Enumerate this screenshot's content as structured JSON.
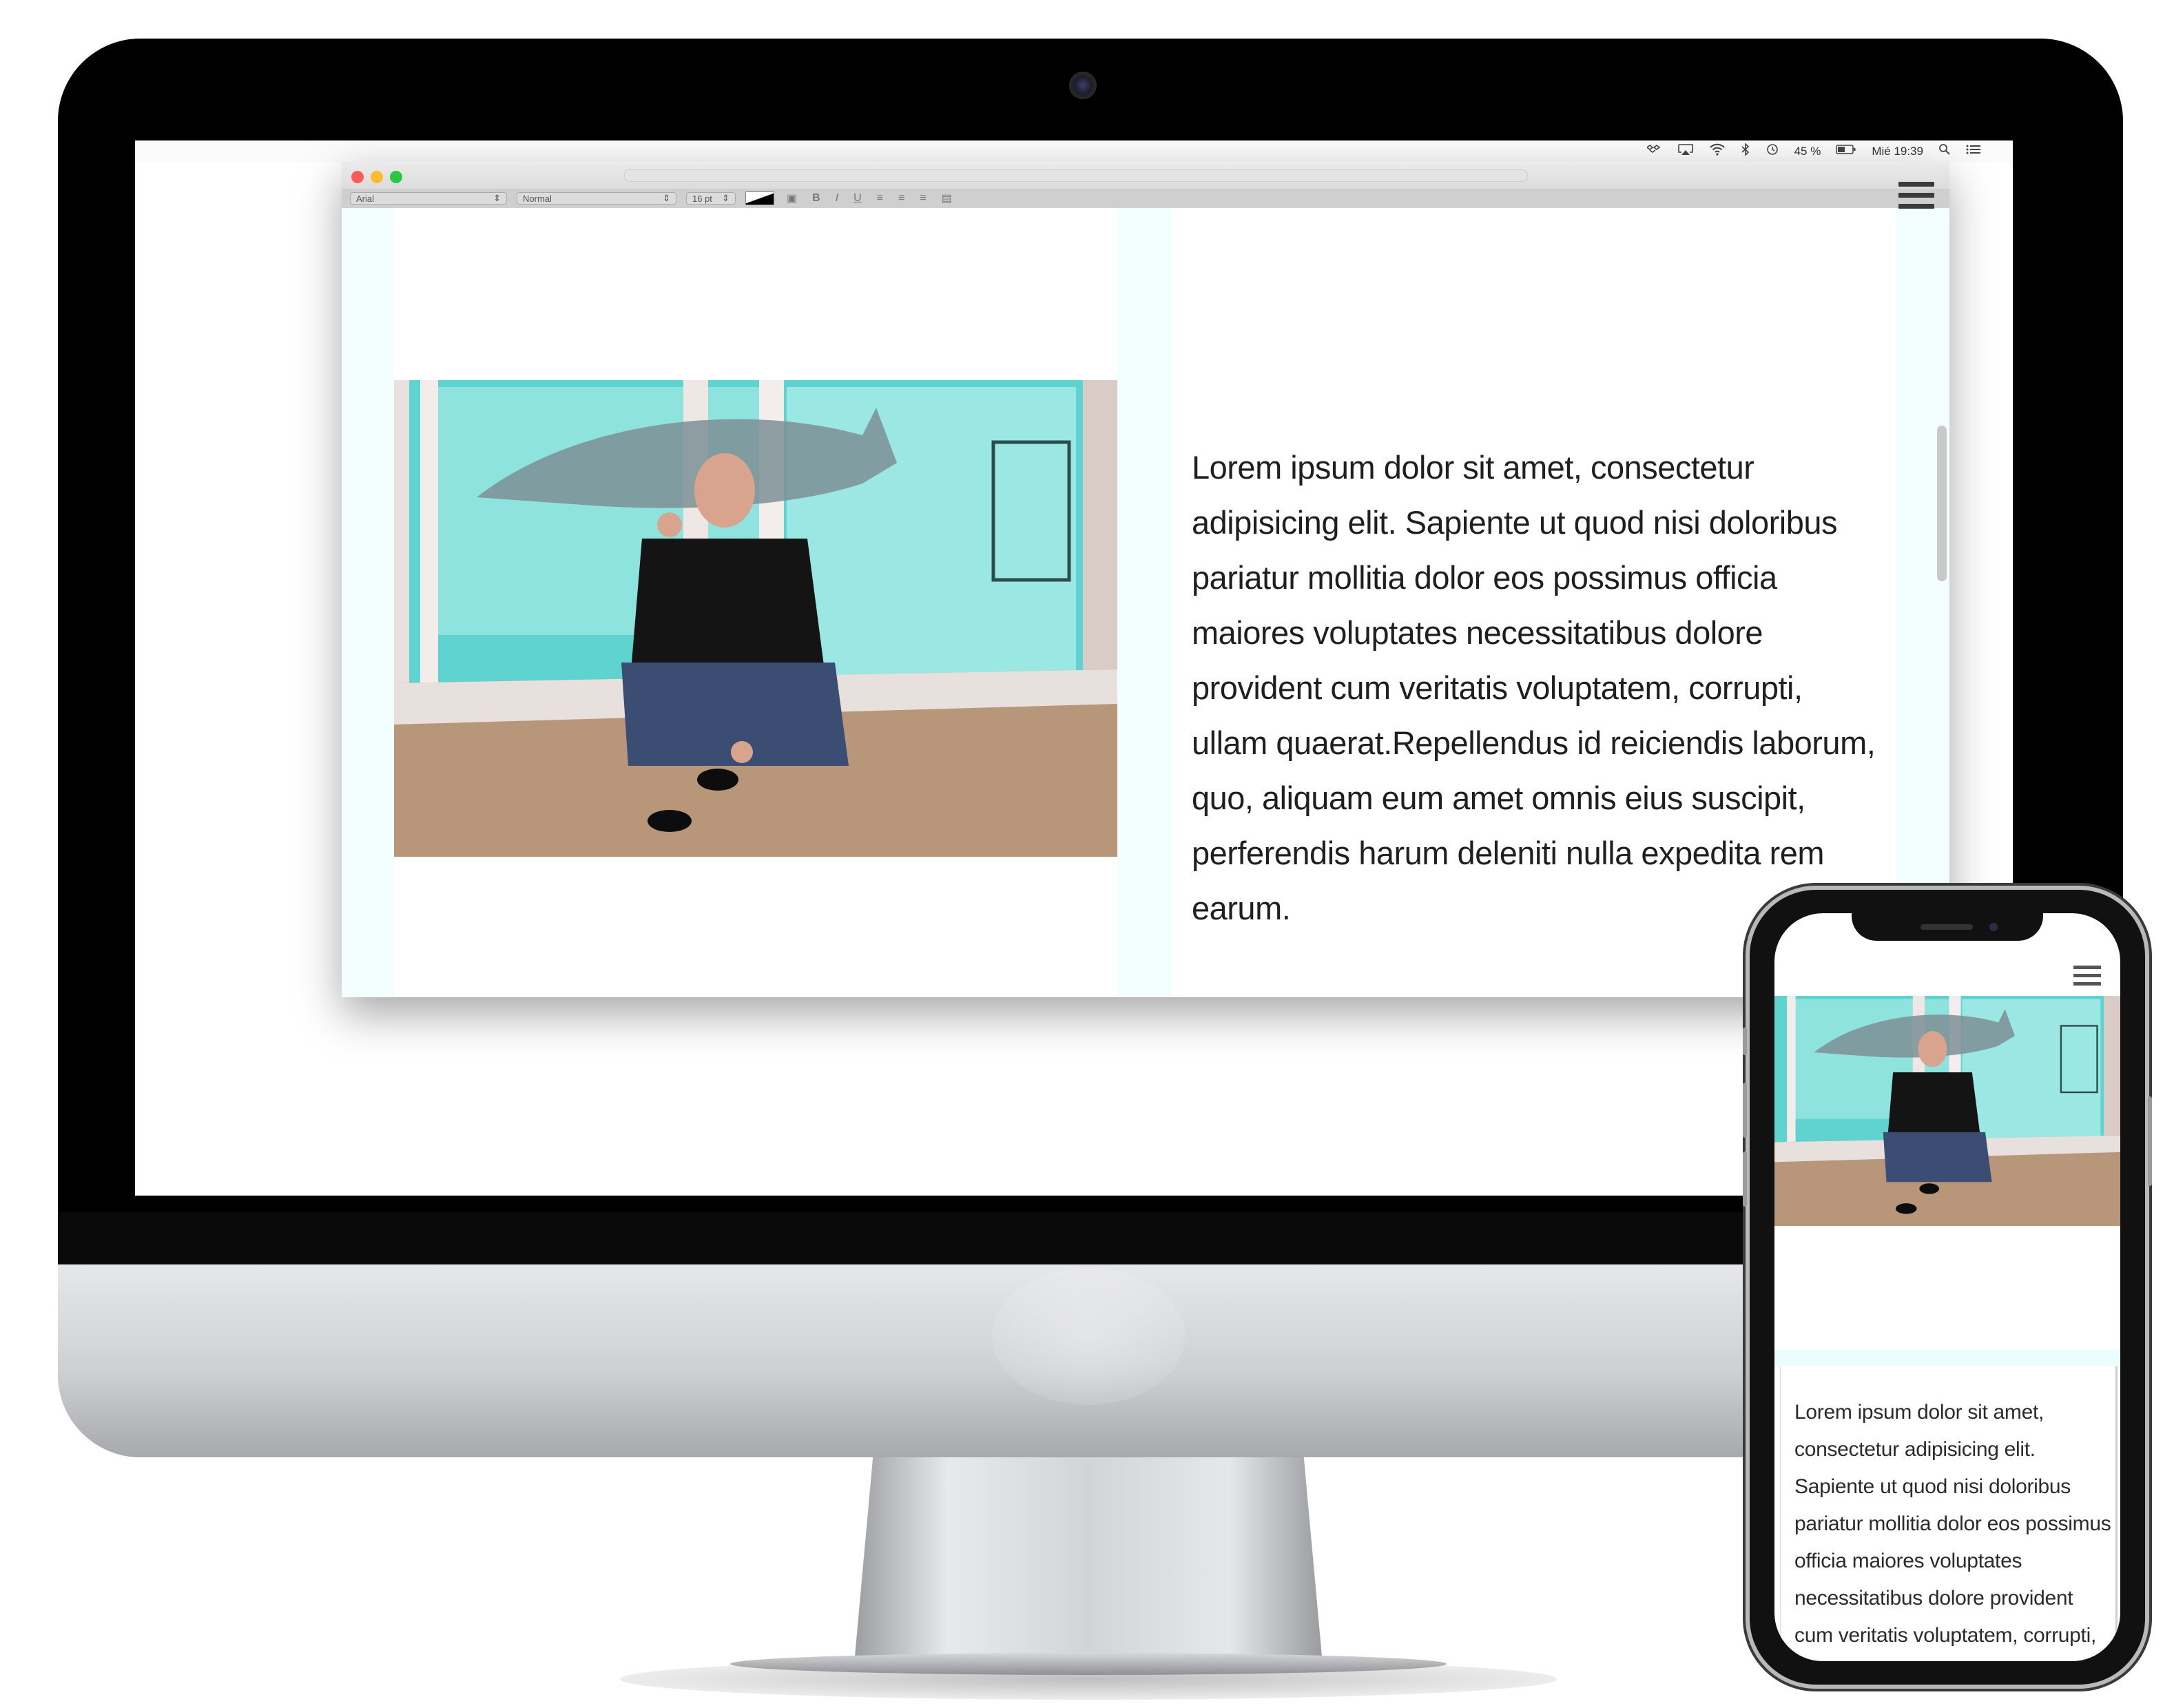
{
  "menubar": {
    "battery_percent": "45 %",
    "clock": "Mié 19:39"
  },
  "toolbar": {
    "font": "Arial",
    "style": "Normal",
    "size": "16 pt",
    "bold": "B",
    "italic": "I",
    "underline": "U"
  },
  "content": {
    "paragraph": "Lorem ipsum dolor sit amet, consectetur adipisicing elit. Sapiente ut quod nisi doloribus pariatur mollitia dolor eos possimus officia maiores voluptates necessitatibus dolore provident cum veritatis voluptatem, corrupti, ullam quaerat.Repellendus id reiciendis laborum, quo, aliquam eum amet omnis eius suscipit, perferendis harum deleniti nulla expedita rem earum."
  },
  "phone": {
    "paragraph": "Lorem ipsum dolor sit amet, consectetur adipisicing elit. Sapiente ut quod nisi doloribus pariatur mollitia dolor eos possimus officia maiores voluptates necessitatibus dolore provident cum veritatis voluptatem, corrupti, ullam quaerat.Repellendus id reiciendis"
  },
  "colors": {
    "page_background": "#f2fffe",
    "card": "#ffffff",
    "text": "#1f1f1f",
    "aquarium": "#5fd3cf"
  },
  "icons": [
    "wifi-icon",
    "airplay-icon",
    "bluetooth-icon",
    "time-machine-icon",
    "battery-icon",
    "spotlight-search-icon",
    "notification-center-icon",
    "hamburger-menu-icon"
  ]
}
